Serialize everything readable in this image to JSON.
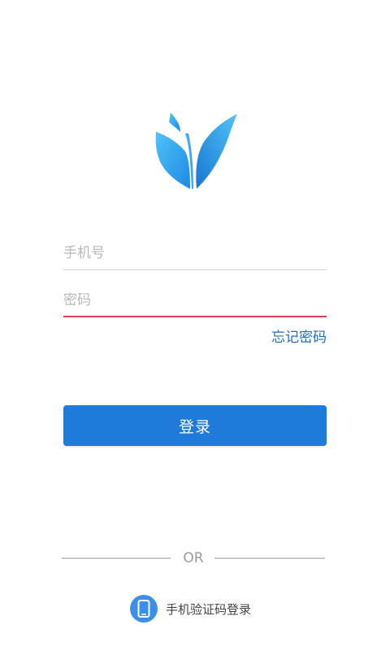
{
  "colors": {
    "accent": "#1f7ad9",
    "logo_light": "#4fc3f7",
    "logo_dark": "#1e88e5",
    "error_underline": "#d0021b",
    "link": "#1b6fb8"
  },
  "logo": {
    "icon": "sprout-leaf-logo"
  },
  "form": {
    "phone_placeholder": "手机号",
    "password_placeholder": "密码",
    "forgot_password": "忘记密码",
    "login_button": "登录"
  },
  "divider": {
    "text": "OR"
  },
  "alt_login": {
    "icon": "smartphone-icon",
    "label": "手机验证码登录"
  }
}
